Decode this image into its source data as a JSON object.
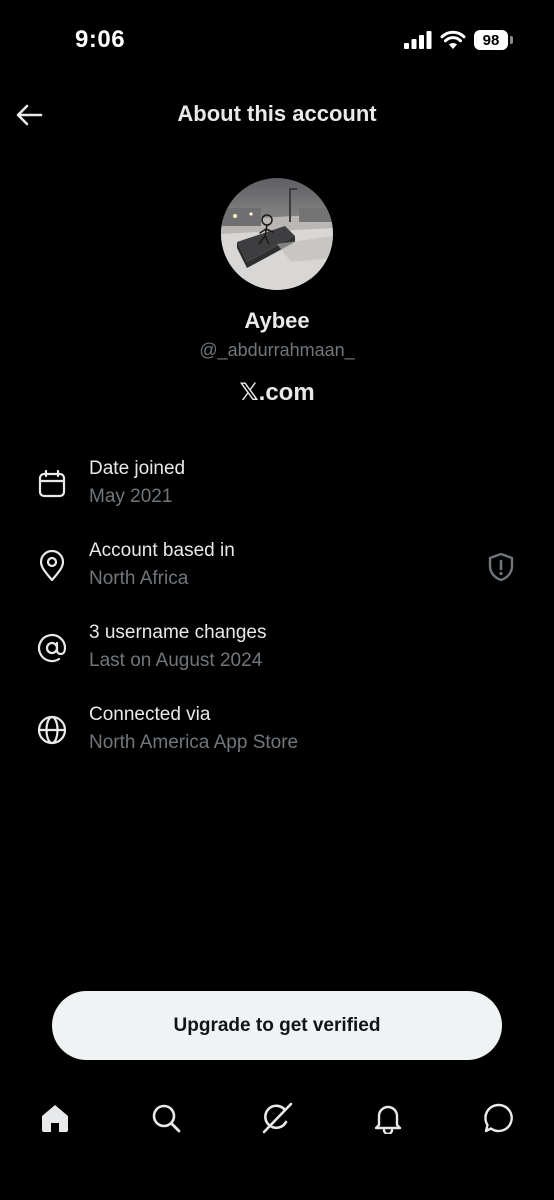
{
  "status_bar": {
    "time": "9:06",
    "battery": "98",
    "icons": [
      "cellular-signal-icon",
      "wifi-icon",
      "battery-icon"
    ]
  },
  "header": {
    "title": "About this account",
    "back_icon": "arrow-left-icon"
  },
  "profile": {
    "name": "Aybee",
    "handle": "@_abdurrahmaan_",
    "platform": "𝕏.com"
  },
  "info_items": [
    {
      "icon": "calendar-icon",
      "title": "Date joined",
      "subtitle": "May 2021"
    },
    {
      "icon": "location-pin-icon",
      "title": "Account based in",
      "subtitle": "North Africa",
      "badge": "shield-alert-icon"
    },
    {
      "icon": "at-sign-icon",
      "title": "3 username changes",
      "subtitle": "Last on August 2024"
    },
    {
      "icon": "globe-icon",
      "title": "Connected via",
      "subtitle": "North America App Store"
    }
  ],
  "cta": {
    "label": "Upgrade to get verified"
  },
  "bottom_nav": {
    "items": [
      "home-icon",
      "search-icon",
      "grok-icon",
      "notifications-icon",
      "messages-icon"
    ],
    "active": "home-icon"
  },
  "colors": {
    "background": "#000000",
    "primary_text": "#e7e9ea",
    "secondary_text": "#71767b",
    "button_bg": "#eff3f4",
    "button_text": "#0f1419"
  }
}
